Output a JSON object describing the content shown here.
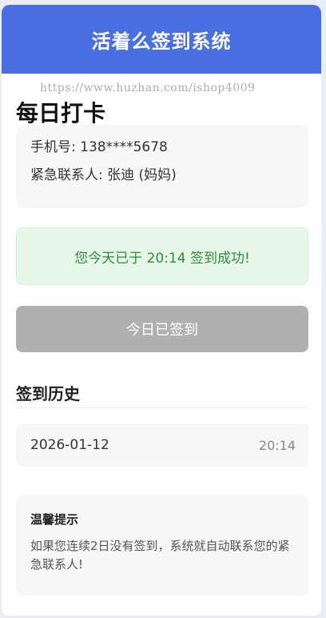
{
  "header": {
    "title": "活着么签到系统"
  },
  "watermark": "https://www.huzhan.com/ishop4009",
  "page": {
    "title": "每日打卡"
  },
  "user": {
    "phone_line": "手机号: 138****5678",
    "contact_line": "紧急联系人: 张迪 (妈妈)"
  },
  "status": {
    "message": "您今天已于 20:14 签到成功!"
  },
  "checkin_button": {
    "label": "今日已签到"
  },
  "history": {
    "title": "签到历史",
    "records": [
      {
        "date": "2026-01-12",
        "time": "20:14"
      }
    ]
  },
  "tip": {
    "title": "温馨提示",
    "text": "如果您连续2日没有签到，系统就自动联系您的紧急联系人!"
  },
  "colors": {
    "header_bg": "#4a6fe0",
    "success_bg": "#e6f6e9",
    "success_text": "#2f8a3f",
    "button_disabled": "#b0b0b0"
  }
}
